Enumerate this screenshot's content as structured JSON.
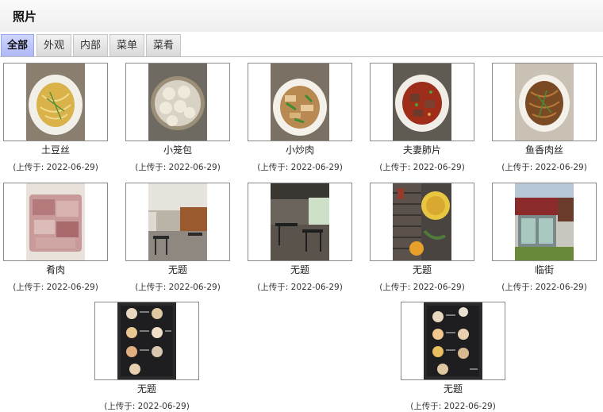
{
  "page": {
    "title": "照片"
  },
  "tabs": [
    {
      "label": "全部",
      "active": true
    },
    {
      "label": "外观",
      "active": false
    },
    {
      "label": "内部",
      "active": false
    },
    {
      "label": "菜单",
      "active": false
    },
    {
      "label": "菜肴",
      "active": false
    }
  ],
  "photos": [
    {
      "name": "土豆丝",
      "date": "(上传于: 2022-06-29)",
      "icon": "shredded-potato-photo"
    },
    {
      "name": "小笼包",
      "date": "(上传于: 2022-06-29)",
      "icon": "soup-dumplings-photo"
    },
    {
      "name": "小炒肉",
      "date": "(上传于: 2022-06-29)",
      "icon": "stir-fry-pork-photo"
    },
    {
      "name": "夫妻肺片",
      "date": "(上传于: 2022-06-29)",
      "icon": "sliced-beef-chili-photo"
    },
    {
      "name": "鱼香肉丝",
      "date": "(上传于: 2022-06-29)",
      "icon": "yuxiang-pork-photo"
    },
    {
      "name": "肴肉",
      "date": "(上传于: 2022-06-29)",
      "icon": "pork-terrine-photo"
    },
    {
      "name": "无题",
      "date": "(上传于: 2022-06-29)",
      "icon": "dining-room-photo"
    },
    {
      "name": "无题",
      "date": "(上传于: 2022-06-29)",
      "icon": "dining-tables-photo"
    },
    {
      "name": "无题",
      "date": "(上传于: 2022-06-29)",
      "icon": "wall-decor-photo"
    },
    {
      "name": "临街",
      "date": "(上传于: 2022-06-29)",
      "icon": "storefront-photo"
    },
    {
      "name": "无题",
      "date": "(上传于: 2022-06-29)",
      "icon": "menu-page-photo"
    },
    {
      "name": "无题",
      "date": "(上传于: 2022-06-29)",
      "icon": "menu-page-photo"
    }
  ]
}
